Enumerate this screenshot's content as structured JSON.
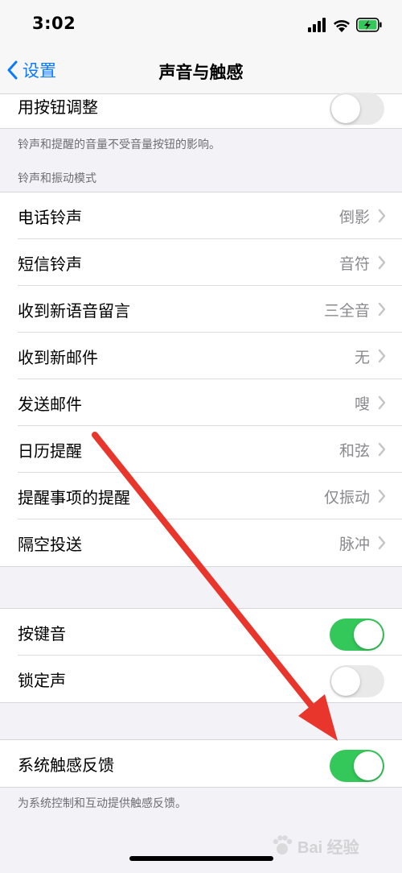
{
  "status_bar": {
    "time": "3:02"
  },
  "nav": {
    "back_label": "设置",
    "title": "声音与触感"
  },
  "top_partial_row": {
    "label": "用按钮调整",
    "toggle_on": false
  },
  "footnotes": {
    "volume_buttons": "铃声和提醒的音量不受音量按钮的影响。",
    "haptics": "为系统控制和互动提供触感反馈。"
  },
  "sections": {
    "ringtone_header": "铃声和振动模式"
  },
  "sound_rows": [
    {
      "label": "电话铃声",
      "value": "倒影"
    },
    {
      "label": "短信铃声",
      "value": "音符"
    },
    {
      "label": "收到新语音留言",
      "value": "三全音"
    },
    {
      "label": "收到新邮件",
      "value": "无"
    },
    {
      "label": "发送邮件",
      "value": "嗖"
    },
    {
      "label": "日历提醒",
      "value": "和弦"
    },
    {
      "label": "提醒事项的提醒",
      "value": "仅振动"
    },
    {
      "label": "隔空投送",
      "value": "脉冲"
    }
  ],
  "toggles": [
    {
      "label": "按键音",
      "on": true
    },
    {
      "label": "锁定声",
      "on": false
    }
  ],
  "haptic_row": {
    "label": "系统触感反馈",
    "on": true
  },
  "watermark": {
    "text": "Bai 经验"
  },
  "colors": {
    "accent": "#0a7aff",
    "toggle_on": "#34c759",
    "toggle_off": "#e9e9ea",
    "annotation_arrow": "#e8362d"
  }
}
